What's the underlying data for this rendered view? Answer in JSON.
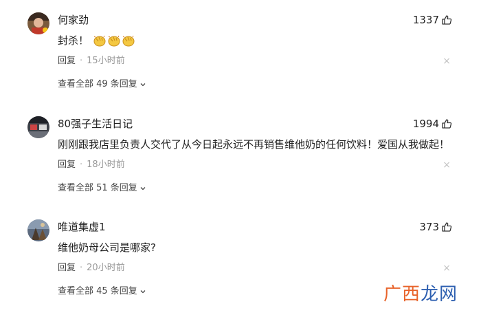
{
  "comments": [
    {
      "username": "何家劲",
      "likes": "1337",
      "text": "封杀！",
      "emojis": [
        "applause-emoji",
        "applause-emoji",
        "applause-emoji"
      ],
      "reply_label": "回复",
      "separator": "·",
      "time": "15小时前",
      "dismiss": "×",
      "view_all": "查看全部 49 条回复"
    },
    {
      "username": "80强子生活日记",
      "likes": "1994",
      "text": "刚刚跟我店里负责人交代了从今日起永远不再销售维他奶的任何饮料！爱国从我做起！",
      "reply_label": "回复",
      "separator": "·",
      "time": "18小时前",
      "dismiss": "×",
      "view_all": "查看全部 51 条回复"
    },
    {
      "username": "唯道集虚1",
      "likes": "373",
      "text": "维他奶母公司是哪家?",
      "reply_label": "回复",
      "separator": "·",
      "time": "20小时前",
      "dismiss": "×",
      "view_all": "查看全部 45 条回复"
    }
  ],
  "icons": {
    "like": "thumbs-up-icon",
    "expand": "chevron-down-icon"
  },
  "watermark": {
    "part1": "广西",
    "part2": "龙网"
  },
  "colors": {
    "text": "#222222",
    "meta": "#999999",
    "watermark_orange": "#e8632a",
    "watermark_blue": "#2d5fb0"
  }
}
